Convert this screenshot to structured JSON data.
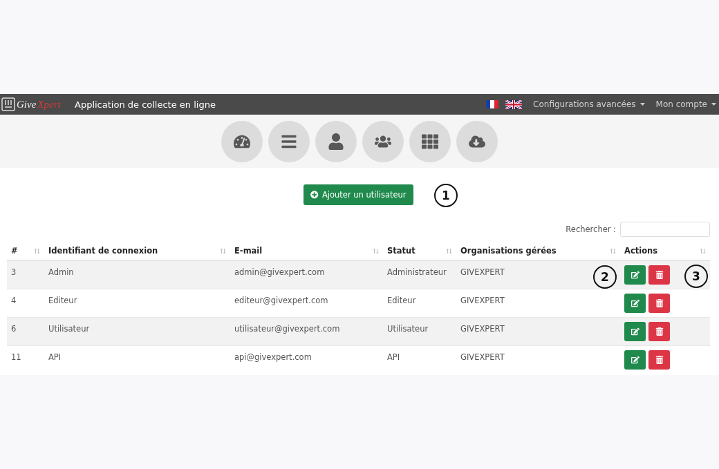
{
  "navbar": {
    "brand": {
      "first": "Give",
      "second": "Xpert"
    },
    "title": "Application de collecte en ligne",
    "menus": [
      {
        "label": "Configurations avancées"
      },
      {
        "label": "Mon compte"
      }
    ]
  },
  "add_button": {
    "label": "Ajouter un utilisateur"
  },
  "search": {
    "label": "Rechercher :"
  },
  "table": {
    "columns": [
      "#",
      "Identifiant de connexion",
      "E-mail",
      "Statut",
      "Organisations gérées",
      "Actions"
    ],
    "rows": [
      {
        "cells": [
          "3",
          "Admin",
          "admin@givexpert.com",
          "Administrateur",
          "GIVEXPERT"
        ]
      },
      {
        "cells": [
          "4",
          "Editeur",
          "editeur@givexpert.com",
          "Editeur",
          "GIVEXPERT"
        ]
      },
      {
        "cells": [
          "6",
          "Utilisateur",
          "utilisateur@givexpert.com",
          "Utilisateur",
          "GIVEXPERT"
        ]
      },
      {
        "cells": [
          "11",
          "API",
          "api@givexpert.com",
          "API",
          "GIVEXPERT"
        ]
      }
    ]
  },
  "callouts": [
    "1",
    "2",
    "3"
  ]
}
